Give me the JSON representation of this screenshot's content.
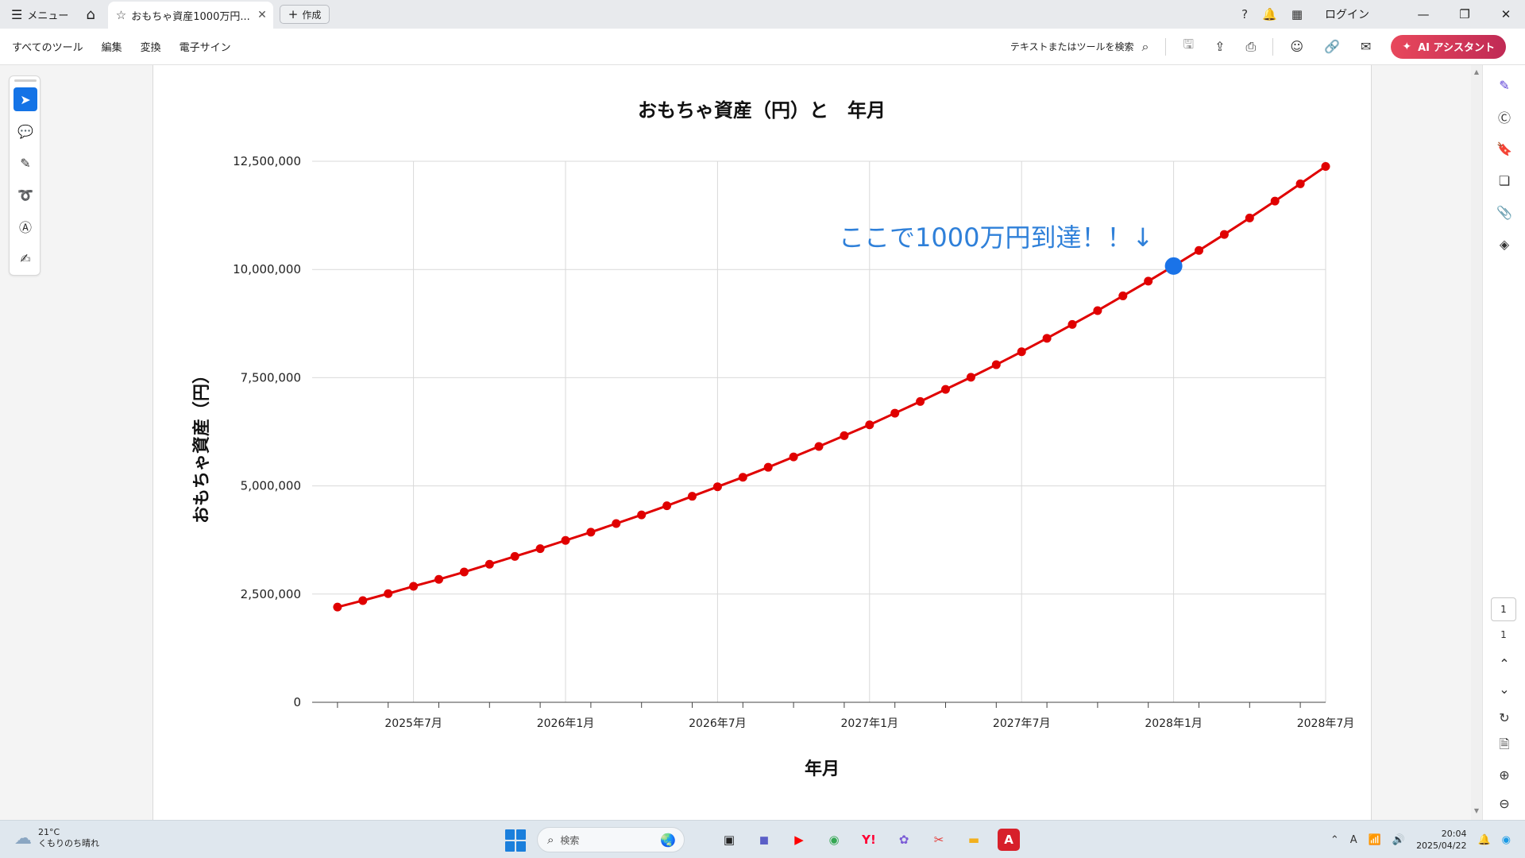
{
  "titlebar": {
    "menu_label": "メニュー",
    "tab_label": "おもちゃ資産1000万円...",
    "create_label": "作成",
    "login_label": "ログイン"
  },
  "toolbar": {
    "all_tools": "すべてのツール",
    "edit": "編集",
    "convert": "変換",
    "esign": "電子サイン",
    "search_text": "テキストまたはツールを検索",
    "ai_label": "AI アシスタント"
  },
  "rightbar": {
    "page_current": "1",
    "page_total": "1"
  },
  "taskbar": {
    "temperature": "21°C",
    "weather": "くもりのち晴れ",
    "search_placeholder": "検索",
    "time": "20:04",
    "date": "2025/04/22",
    "ime": "A"
  },
  "chart_data": {
    "type": "line",
    "title": "おもちゃ資産（円）と　年月",
    "xlabel": "年月",
    "ylabel": "おもちゃ資産（円）",
    "ylim": [
      0,
      12500000
    ],
    "yticks": [
      0,
      2500000,
      5000000,
      7500000,
      10000000,
      12500000
    ],
    "ytick_labels": [
      "0",
      "2,500,000",
      "5,000,000",
      "7,500,000",
      "10,000,000",
      "12,500,000"
    ],
    "xlim": [
      "2025-03",
      "2028-07"
    ],
    "xtick_labels": [
      {
        "date": "2025-07",
        "label": "2025年7月"
      },
      {
        "date": "2026-01",
        "label": "2026年1月"
      },
      {
        "date": "2026-07",
        "label": "2026年7月"
      },
      {
        "date": "2027-01",
        "label": "2027年1月"
      },
      {
        "date": "2027-07",
        "label": "2027年7月"
      },
      {
        "date": "2028-01",
        "label": "2028年1月"
      },
      {
        "date": "2028-07",
        "label": "2028年7月"
      }
    ],
    "grid": true,
    "legend": "none",
    "line_color": "#e00000",
    "highlight_color": "#1a73e8",
    "x": [
      "2025-04",
      "2025-05",
      "2025-06",
      "2025-07",
      "2025-08",
      "2025-09",
      "2025-10",
      "2025-11",
      "2025-12",
      "2026-01",
      "2026-02",
      "2026-03",
      "2026-04",
      "2026-05",
      "2026-06",
      "2026-07",
      "2026-08",
      "2026-09",
      "2026-10",
      "2026-11",
      "2026-12",
      "2027-01",
      "2027-02",
      "2027-03",
      "2027-04",
      "2027-05",
      "2027-06",
      "2027-07",
      "2027-08",
      "2027-09",
      "2027-10",
      "2027-11",
      "2027-12",
      "2028-01",
      "2028-02",
      "2028-03",
      "2028-04",
      "2028-05",
      "2028-06",
      "2028-07"
    ],
    "values": [
      2200000,
      2350000,
      2510000,
      2680000,
      2840000,
      3010000,
      3190000,
      3370000,
      3550000,
      3740000,
      3930000,
      4130000,
      4330000,
      4540000,
      4760000,
      4980000,
      5200000,
      5430000,
      5670000,
      5910000,
      6160000,
      6410000,
      6680000,
      6950000,
      7230000,
      7510000,
      7800000,
      8100000,
      8410000,
      8730000,
      9050000,
      9390000,
      9730000,
      10080000,
      10440000,
      10810000,
      11190000,
      11580000,
      11980000,
      12380000
    ],
    "highlight_index": 33,
    "annotation": "ここで1000万円到達！！↓"
  }
}
